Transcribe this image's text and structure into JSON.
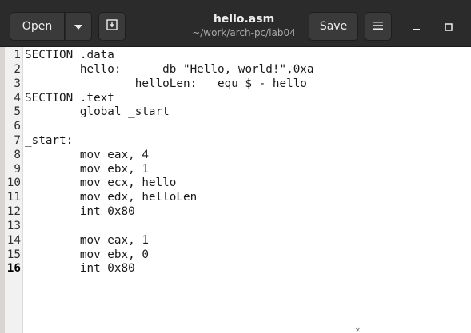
{
  "header": {
    "open_label": "Open",
    "save_label": "Save",
    "title": "hello.asm",
    "subtitle": "~/work/arch-pc/lab04",
    "icons": {
      "open_menu": "chevron-down-icon",
      "new_tab": "new-tab-icon",
      "hamburger": "hamburger-menu-icon",
      "minimize": "minimize-icon",
      "maximize": "maximize-icon"
    }
  },
  "editor": {
    "current_line": 16,
    "lines": [
      {
        "n": "1",
        "text": "SECTION .data"
      },
      {
        "n": "2",
        "text": "        hello:      db \"Hello, world!\",0xa"
      },
      {
        "n": "3",
        "text": "                helloLen:   equ $ - hello"
      },
      {
        "n": "4",
        "text": "SECTION .text"
      },
      {
        "n": "5",
        "text": "        global _start"
      },
      {
        "n": "6",
        "text": ""
      },
      {
        "n": "7",
        "text": "_start:"
      },
      {
        "n": "8",
        "text": "        mov eax, 4"
      },
      {
        "n": "9",
        "text": "        mov ebx, 1"
      },
      {
        "n": "10",
        "text": "        mov ecx, hello"
      },
      {
        "n": "11",
        "text": "        mov edx, helloLen"
      },
      {
        "n": "12",
        "text": "        int 0x80"
      },
      {
        "n": "13",
        "text": ""
      },
      {
        "n": "14",
        "text": "        mov eax, 1"
      },
      {
        "n": "15",
        "text": "        mov ebx, 0"
      },
      {
        "n": "16",
        "text": "        int 0x80"
      }
    ]
  },
  "colors": {
    "headerbar": "#2b2b2b",
    "editor_bg": "#ffffff",
    "gutter_bg": "#f1f1f1"
  }
}
